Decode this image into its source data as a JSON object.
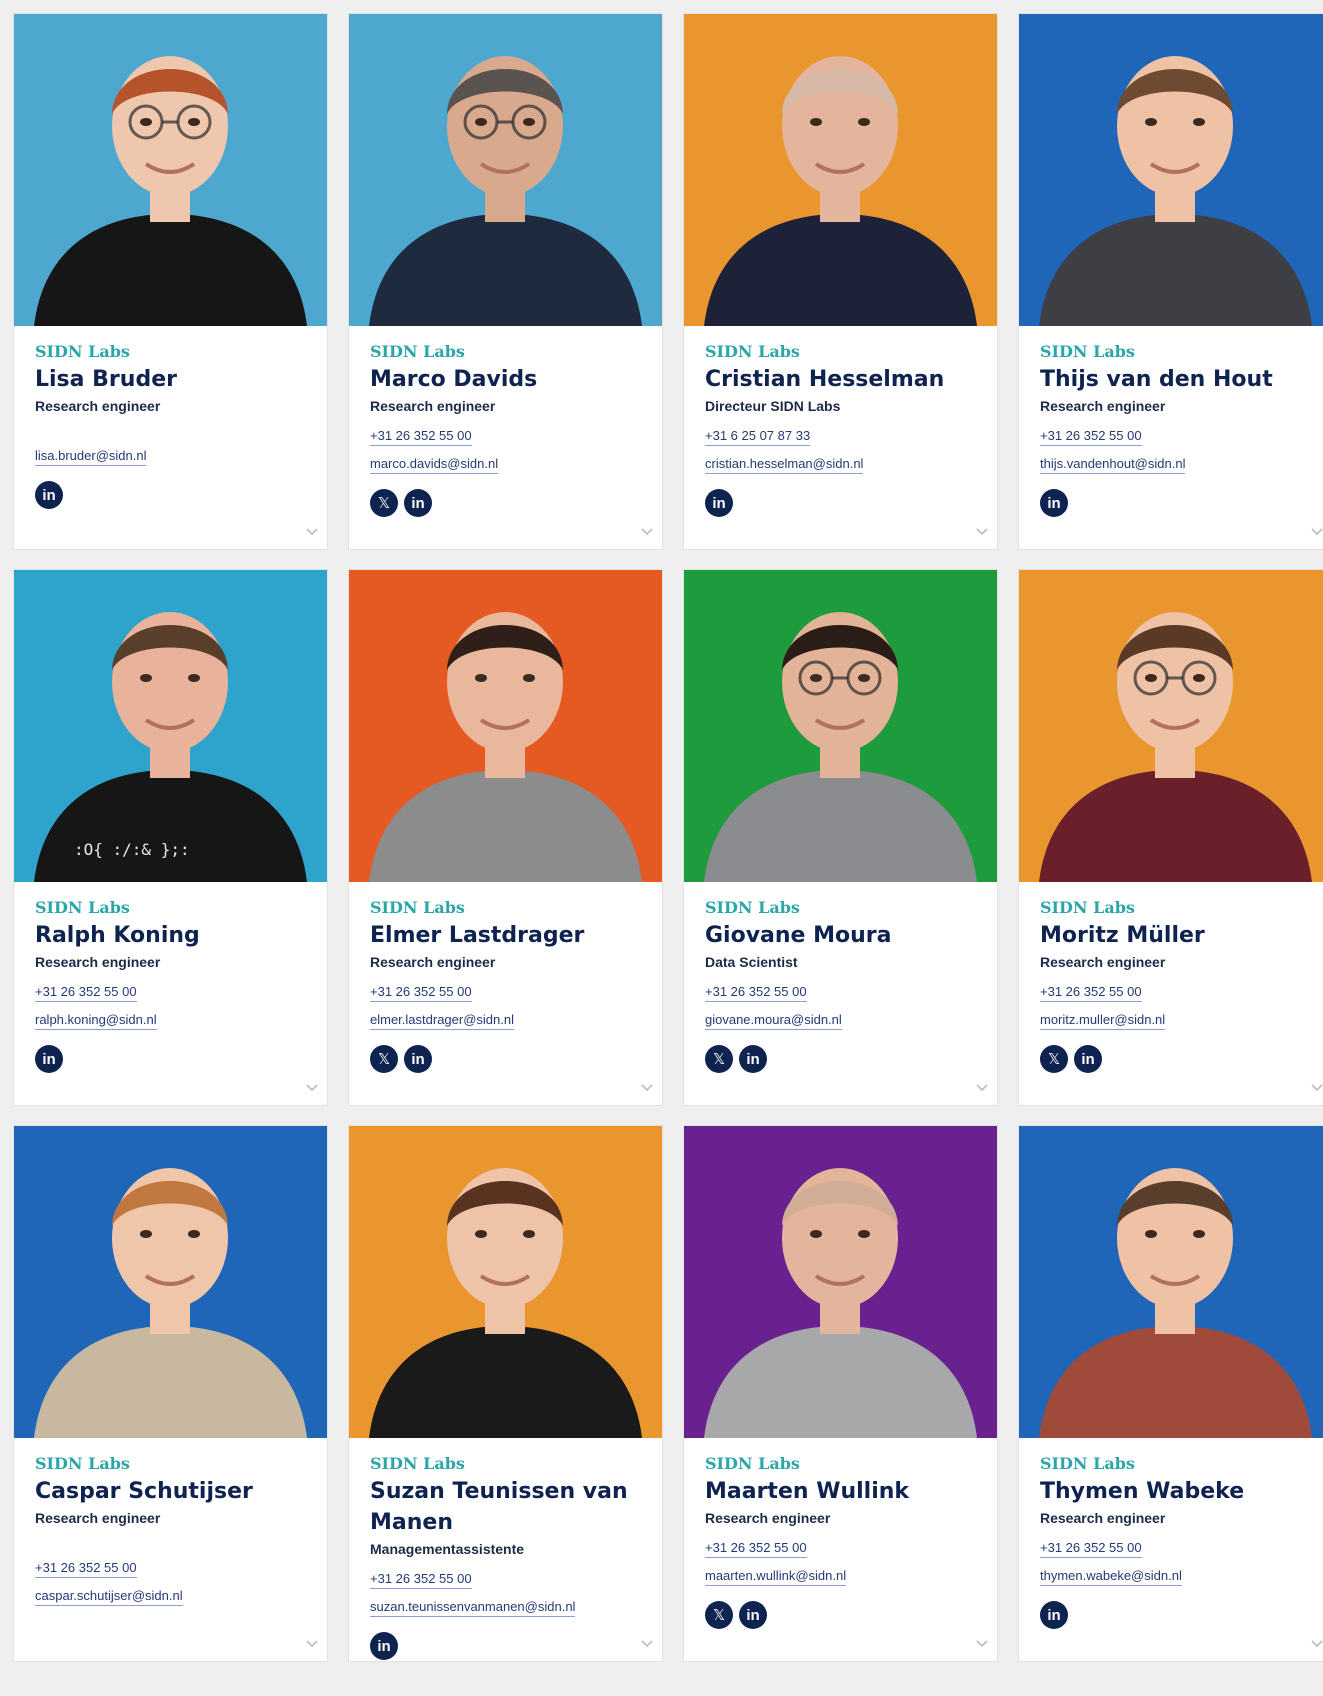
{
  "people": [
    {
      "org": "SIDN Labs",
      "name": "Lisa Bruder",
      "role": "Research engineer",
      "phone": "",
      "email": "lisa.bruder@sidn.nl",
      "socials": [
        "in"
      ],
      "bg": "#4ea7cf",
      "shirt": "#161616",
      "hair": "#b5532a",
      "skin": "#efc7ae",
      "glasses": true
    },
    {
      "org": "SIDN Labs",
      "name": "Marco Davids",
      "role": "Research engineer",
      "phone": "+31 26 352 55 00",
      "email": "marco.davids@sidn.nl",
      "socials": [
        "x",
        "in"
      ],
      "bg": "#4ea7cf",
      "shirt": "#1e2a3e",
      "hair": "#5b5350",
      "skin": "#d9a98e",
      "glasses": true
    },
    {
      "org": "SIDN Labs",
      "name": "Cristian Hesselman",
      "role": "Directeur SIDN Labs",
      "phone": "+31 6 25 07 87 33",
      "email": "cristian.hesselman@sidn.nl",
      "socials": [
        "in"
      ],
      "bg": "#e9962f",
      "shirt": "#1d2238",
      "hair": "#d8b9a8",
      "skin": "#e3b59c",
      "glasses": false
    },
    {
      "org": "SIDN Labs",
      "name": "Thijs van den Hout",
      "role": "Research engineer",
      "phone": "+31 26 352 55 00",
      "email": "thijs.vandenhout@sidn.nl",
      "socials": [
        "in"
      ],
      "bg": "#1f66b8",
      "shirt": "#3d3f44",
      "hair": "#6e4a30",
      "skin": "#efc2a5",
      "glasses": false
    },
    {
      "org": "SIDN Labs",
      "name": "Ralph Koning",
      "role": "Research engineer",
      "phone": "+31 26 352 55 00",
      "email": "ralph.koning@sidn.nl",
      "socials": [
        "in"
      ],
      "bg": "#2ea3cc",
      "shirt": "#161616",
      "hair": "#5a3e2c",
      "skin": "#e8b39a",
      "glasses": false
    },
    {
      "org": "SIDN Labs",
      "name": "Elmer Lastdrager",
      "role": "Research engineer",
      "phone": "+31 26 352 55 00",
      "email": "elmer.lastdrager@sidn.nl",
      "socials": [
        "x",
        "in"
      ],
      "bg": "#e45a22",
      "shirt": "#8c8c8c",
      "hair": "#2f1f18",
      "skin": "#e8b79c",
      "glasses": false
    },
    {
      "org": "SIDN Labs",
      "name": "Giovane Moura",
      "role": "Data Scientist",
      "phone": "+31 26 352 55 00",
      "email": "giovane.moura@sidn.nl",
      "socials": [
        "x",
        "in"
      ],
      "bg": "#1e9b3c",
      "shirt": "#8a8c8f",
      "hair": "#2a1c16",
      "skin": "#e2b397",
      "glasses": true
    },
    {
      "org": "SIDN Labs",
      "name": "Moritz Müller",
      "role": "Research engineer",
      "phone": "+31 26 352 55 00",
      "email": "moritz.muller@sidn.nl",
      "socials": [
        "x",
        "in"
      ],
      "bg": "#e9962f",
      "shirt": "#6b1f2a",
      "hair": "#5a3a26",
      "skin": "#efc2a5",
      "glasses": true
    },
    {
      "org": "SIDN Labs",
      "name": "Caspar Schutijser",
      "role": "Research engineer",
      "phone": "+31 26 352 55 00",
      "email": "caspar.schutijser@sidn.nl",
      "socials": [],
      "bg": "#1f66b8",
      "shirt": "#c8b8a0",
      "hair": "#c07840",
      "skin": "#f0c6aa",
      "glasses": false
    },
    {
      "org": "SIDN Labs",
      "name": "Suzan Teunissen van Manen",
      "role": "Managementassistente",
      "phone": "+31 26 352 55 00",
      "email": "suzan.teunissenvanmanen@sidn.nl",
      "socials": [
        "in"
      ],
      "bg": "#e9962f",
      "shirt": "#1a1a1a",
      "hair": "#5a3320",
      "skin": "#efc3a8",
      "glasses": false
    },
    {
      "org": "SIDN Labs",
      "name": "Maarten Wullink",
      "role": "Research engineer",
      "phone": "+31 26 352 55 00",
      "email": "maarten.wullink@sidn.nl",
      "socials": [
        "x",
        "in"
      ],
      "bg": "#6a2190",
      "shirt": "#a8a8ab",
      "hair": "#d2ad95",
      "skin": "#e3b59c",
      "glasses": false
    },
    {
      "org": "SIDN Labs",
      "name": "Thymen Wabeke",
      "role": "Research engineer",
      "phone": "+31 26 352 55 00",
      "email": "thymen.wabeke@sidn.nl",
      "socials": [
        "in"
      ],
      "bg": "#1f66b8",
      "shirt": "#a04a3c",
      "hair": "#5a3e2c",
      "skin": "#efc2a5",
      "glasses": false
    }
  ],
  "icons": {
    "x": "x-icon",
    "in": "linkedin-icon",
    "expand": "chevron-down-icon"
  },
  "social_labels": {
    "x": "𝕏",
    "in": "in"
  },
  "colors": {
    "org": "#2aa5a8",
    "name": "#0f2350",
    "link": "#243a76",
    "social_bg": "#0f2350"
  },
  "shirt_text": ":O{ :/:& };:"
}
